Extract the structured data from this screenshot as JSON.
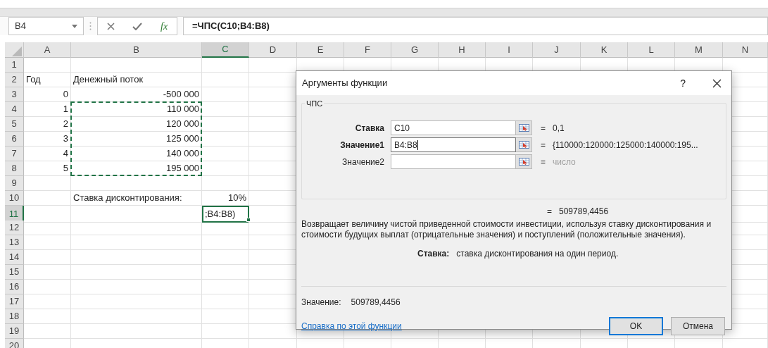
{
  "formula_bar": {
    "name_box": "B4",
    "fx": "fx",
    "formula": "=ЧПС(C10;B4:B8)"
  },
  "columns": [
    {
      "label": "A",
      "selected": false
    },
    {
      "label": "B",
      "selected": false
    },
    {
      "label": "C",
      "selected": true
    },
    {
      "label": "D",
      "selected": false
    },
    {
      "label": "E",
      "selected": false
    },
    {
      "label": "F",
      "selected": false
    },
    {
      "label": "G",
      "selected": false
    },
    {
      "label": "H",
      "selected": false
    },
    {
      "label": "I",
      "selected": false
    },
    {
      "label": "J",
      "selected": false
    },
    {
      "label": "K",
      "selected": false
    },
    {
      "label": "L",
      "selected": false
    },
    {
      "label": "M",
      "selected": false
    },
    {
      "label": "N",
      "selected": false
    }
  ],
  "rows": [
    {
      "number": "1",
      "selected": false
    },
    {
      "number": "2",
      "selected": false,
      "a": {
        "text": "Год",
        "kind": "text"
      },
      "b": {
        "text": "Денежный поток",
        "kind": "text"
      }
    },
    {
      "number": "3",
      "selected": false,
      "a": {
        "text": "0",
        "kind": "number"
      },
      "b": {
        "text": "-500 000",
        "kind": "number"
      }
    },
    {
      "number": "4",
      "selected": false,
      "a": {
        "text": "1",
        "kind": "number"
      },
      "b": {
        "text": "110 000",
        "kind": "number",
        "marquee": true
      }
    },
    {
      "number": "5",
      "selected": false,
      "a": {
        "text": "2",
        "kind": "number"
      },
      "b": {
        "text": "120 000",
        "kind": "number",
        "marquee": true
      }
    },
    {
      "number": "6",
      "selected": false,
      "a": {
        "text": "3",
        "kind": "number"
      },
      "b": {
        "text": "125 000",
        "kind": "number",
        "marquee": true
      }
    },
    {
      "number": "7",
      "selected": false,
      "a": {
        "text": "4",
        "kind": "number"
      },
      "b": {
        "text": "140 000",
        "kind": "number",
        "marquee": true
      }
    },
    {
      "number": "8",
      "selected": false,
      "a": {
        "text": "5",
        "kind": "number"
      },
      "b": {
        "text": "195 000",
        "kind": "number",
        "marquee": true
      }
    },
    {
      "number": "9",
      "selected": false
    },
    {
      "number": "10",
      "selected": false,
      "b": {
        "text": "Ставка дисконтирования:",
        "kind": "text"
      },
      "c": {
        "text": "10%",
        "kind": "number"
      }
    },
    {
      "number": "11",
      "selected": true,
      "c": {
        "text": ";B4:B8)",
        "kind": "text"
      }
    },
    {
      "number": "12",
      "selected": false
    },
    {
      "number": "13",
      "selected": false
    },
    {
      "number": "14",
      "selected": false
    },
    {
      "number": "15",
      "selected": false
    },
    {
      "number": "16",
      "selected": false
    },
    {
      "number": "17",
      "selected": false
    },
    {
      "number": "18",
      "selected": false
    },
    {
      "number": "19",
      "selected": false
    },
    {
      "number": "20",
      "selected": false
    }
  ],
  "dialog": {
    "title": "Аргументы функции",
    "help": "?",
    "group": "ЧПС",
    "arguments": [
      {
        "label": "Ставка",
        "required": true,
        "value": "C10",
        "focused": false,
        "equals": "=",
        "result": "0,1",
        "muted": false
      },
      {
        "label": "Значение1",
        "required": true,
        "value": "B4:B8",
        "focused": true,
        "equals": "=",
        "result": "{110000:120000:125000:140000:195...",
        "muted": false
      },
      {
        "label": "Значение2",
        "required": false,
        "focused": false,
        "equals": "=",
        "result": "число",
        "muted": true
      }
    ],
    "formula_equals": "=",
    "formula_result": "509789,4456",
    "description": "Возвращает величину чистой приведенной стоимости инвестиции, используя ставку дисконтирования и стоимости будущих выплат (отрицательные значения) и поступлений (положительные значения).",
    "argument_help": {
      "label": "Ставка:",
      "text": "ставка дисконтирования на один период."
    },
    "value": {
      "label": "Значение:",
      "text": "509789,4456"
    },
    "help_link": "Справка по этой функции",
    "buttons": [
      {
        "label": "OK",
        "default": true
      },
      {
        "label": "Отмена",
        "default": false
      }
    ]
  }
}
